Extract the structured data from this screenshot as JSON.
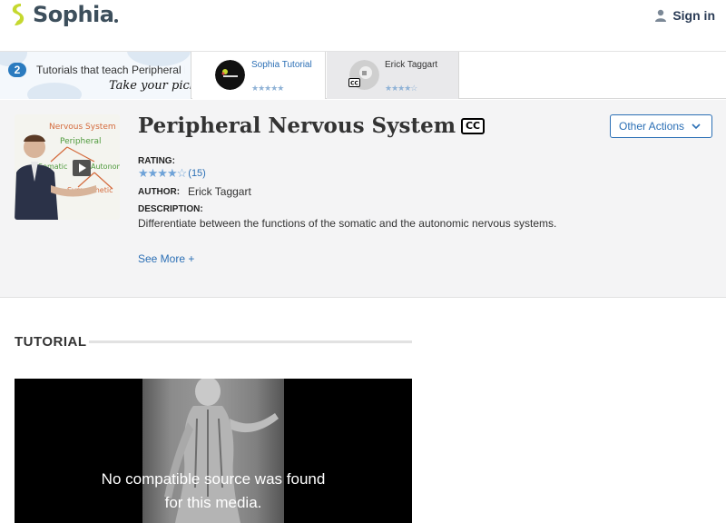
{
  "header": {
    "logo_text": "Sophia",
    "signin_label": "Sign in"
  },
  "tutorials_strip": {
    "count": "2",
    "title": "Tutorials that teach Peripheral Nervous System",
    "pick_label": "Take your pick:",
    "items": [
      {
        "name": "Sophia Tutorial",
        "stars": "★★★★★"
      },
      {
        "name": "Erick Taggart",
        "stars": "★★★★☆"
      }
    ]
  },
  "info": {
    "title": "Peripheral Nervous System",
    "cc_label": "CC",
    "other_actions_label": "Other Actions",
    "rating_label": "RATING:",
    "rating_stars": "★★★★☆",
    "rating_count": "(15)",
    "rating_value": 4,
    "author_label": "AUTHOR:",
    "author_name": "Erick Taggart",
    "description_label": "DESCRIPTION:",
    "description": "Differentiate between the functions of the somatic and the autonomic nervous systems.",
    "see_more_label": "See More +",
    "thumbnail_board_text": [
      "Nervous System",
      "Peripheral",
      "Somatic",
      "Autonomic",
      "Sympathetic"
    ]
  },
  "tutorial_section": {
    "heading": "TUTORIAL",
    "video_error_line1": "No compatible source was found",
    "video_error_line2": "for this media."
  },
  "colors": {
    "brand_green": "#c5d82f",
    "link_blue": "#2b6fb5",
    "badge_blue": "#2b7bbf",
    "star_blue": "#6fa3d8",
    "logo_dark": "#3d4f5c"
  },
  "icons": {
    "signin": "person-icon",
    "play": "play-icon",
    "dropdown": "chevron-down-icon",
    "captions": "closed-captions-icon"
  }
}
